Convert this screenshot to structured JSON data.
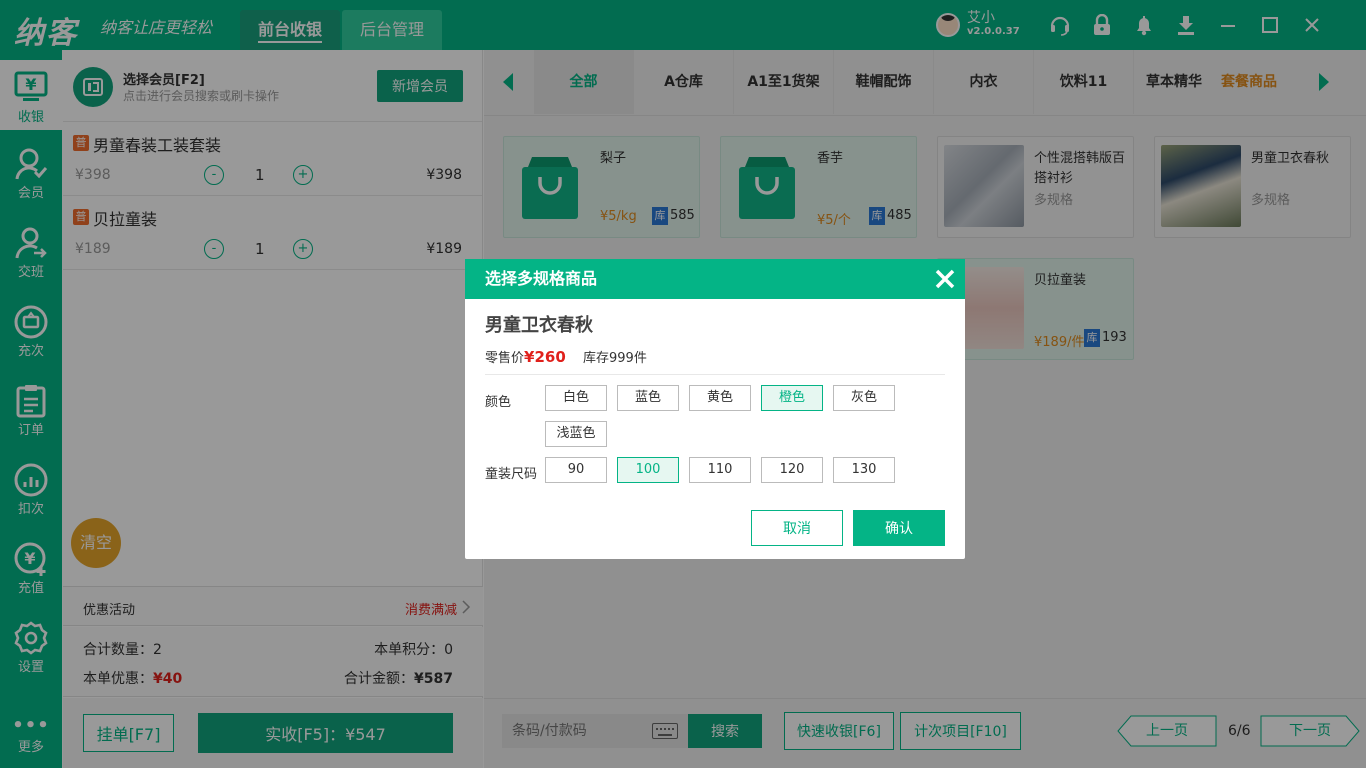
{
  "header": {
    "logo": "纳客",
    "slogan": "纳客让店更轻松",
    "tabs": [
      {
        "label": "前台收银"
      },
      {
        "label": "后台管理"
      }
    ],
    "user_name": "艾小",
    "version": "v2.0.0.37"
  },
  "sidebar": {
    "items": [
      {
        "label": "收银",
        "glyph": "¥"
      },
      {
        "label": "会员"
      },
      {
        "label": "交班"
      },
      {
        "label": "充次"
      },
      {
        "label": "订单"
      },
      {
        "label": "扣次"
      },
      {
        "label": "充值",
        "glyph": "¥"
      },
      {
        "label": "设置"
      },
      {
        "label": "更多",
        "glyph": "•••"
      }
    ]
  },
  "member": {
    "title": "选择会员[F2]",
    "subtitle": "点击进行会员搜索或刷卡操作",
    "add_button": "新增会员"
  },
  "cart": {
    "tag": "普",
    "items": [
      {
        "name": "男童春装工装套装",
        "price": "¥398",
        "qty": "1",
        "total": "¥398"
      },
      {
        "name": "贝拉童装",
        "price": "¥189",
        "qty": "1",
        "total": "¥189"
      }
    ],
    "minus": "-",
    "plus": "+",
    "clear_button": "清空"
  },
  "promo": {
    "label": "优惠活动",
    "value": "消费满减"
  },
  "summary": {
    "count_label": "合计数量：",
    "count_value": "2",
    "points_label": "本单积分：",
    "points_value": "0",
    "discount_label": "本单优惠：",
    "discount_value": "¥40",
    "total_label": "合计金额：",
    "total_value": "¥587"
  },
  "actions": {
    "hold_button": "挂单[F7]",
    "pay_button": "实收[F5]：¥547"
  },
  "categories": [
    {
      "label": "全部"
    },
    {
      "label": "A仓库"
    },
    {
      "label": "A1至1货架"
    },
    {
      "label": "鞋帽配饰"
    },
    {
      "label": "内衣"
    },
    {
      "label": "饮料11"
    },
    {
      "label": "草本精华"
    },
    {
      "label": "套餐商品"
    }
  ],
  "stock_tag": "库",
  "products": [
    {
      "name": "梨子",
      "price": "¥5/kg",
      "stock": "585"
    },
    {
      "name": "香芋",
      "price": "¥5/个",
      "stock": "485"
    },
    {
      "name": "个性混搭韩版百搭衬衫",
      "spec": "多规格"
    },
    {
      "name": "男童卫衣春秋",
      "spec": "多规格"
    },
    {
      "name": "贝拉童装",
      "price": "¥189/件",
      "stock": "193"
    }
  ],
  "footer": {
    "barcode_placeholder": "条码/付款码",
    "search_button": "搜索",
    "quick_button": "快速收银[F6]",
    "count_item_button": "计次项目[F10]",
    "prev_page": "上一页",
    "next_page": "下一页",
    "page_indicator": "6/6"
  },
  "modal": {
    "title": "选择多规格商品",
    "product_name": "男童卫衣春秋",
    "price_label": "零售价",
    "price_value": "¥260",
    "stock": "库存999件",
    "color_label": "颜色",
    "colors": [
      {
        "label": "白色"
      },
      {
        "label": "蓝色"
      },
      {
        "label": "黄色"
      },
      {
        "label": "橙色"
      },
      {
        "label": "灰色"
      },
      {
        "label": "浅蓝色"
      }
    ],
    "selected_color": "橙色",
    "size_label": "童装尺码",
    "sizes": [
      {
        "label": "90"
      },
      {
        "label": "100"
      },
      {
        "label": "110"
      },
      {
        "label": "120"
      },
      {
        "label": "130"
      }
    ],
    "selected_size": "100",
    "cancel_button": "取消",
    "confirm_button": "确认"
  },
  "colors": {
    "primary": "#04b486",
    "dark": "#11a47d",
    "accent_red": "#e0201b",
    "orange": "#e08a1e"
  }
}
